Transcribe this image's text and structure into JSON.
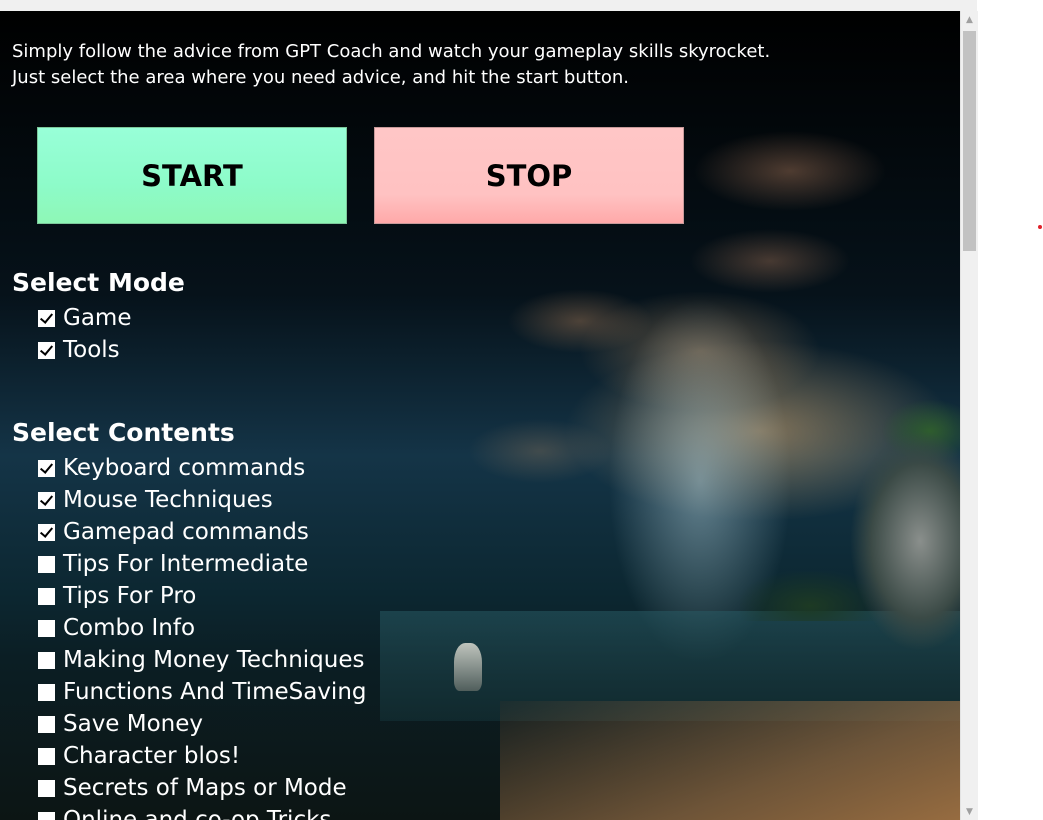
{
  "intro": {
    "line1": "Simply follow the advice from GPT Coach and watch your gameplay skills skyrocket.",
    "line2": "Just select the area where you need advice, and hit the start button."
  },
  "buttons": {
    "start_label": "START",
    "stop_label": "STOP"
  },
  "mode": {
    "title": "Select Mode",
    "items": [
      {
        "label": "Game",
        "checked": true
      },
      {
        "label": "Tools",
        "checked": true
      }
    ]
  },
  "contents": {
    "title": "Select Contents",
    "items": [
      {
        "label": "Keyboard commands",
        "checked": true
      },
      {
        "label": "Mouse Techniques",
        "checked": true
      },
      {
        "label": "Gamepad commands",
        "checked": true
      },
      {
        "label": "Tips For Intermediate",
        "checked": false
      },
      {
        "label": "Tips For Pro",
        "checked": false
      },
      {
        "label": "Combo Info",
        "checked": false
      },
      {
        "label": "Making Money Techniques",
        "checked": false
      },
      {
        "label": "Functions And TimeSaving",
        "checked": false
      },
      {
        "label": "Save Money",
        "checked": false
      },
      {
        "label": "Character blos!",
        "checked": false
      },
      {
        "label": "Secrets of Maps or Mode",
        "checked": false
      },
      {
        "label": "Online and co-op Tricks",
        "checked": false
      }
    ]
  },
  "scrollbar": {
    "up_icon": "chevron-up-icon",
    "down_icon": "chevron-down-icon"
  },
  "colors": {
    "start_button": "#8ef7b6",
    "stop_button": "#ffc2c2",
    "marker_dot": "#e0202a"
  }
}
